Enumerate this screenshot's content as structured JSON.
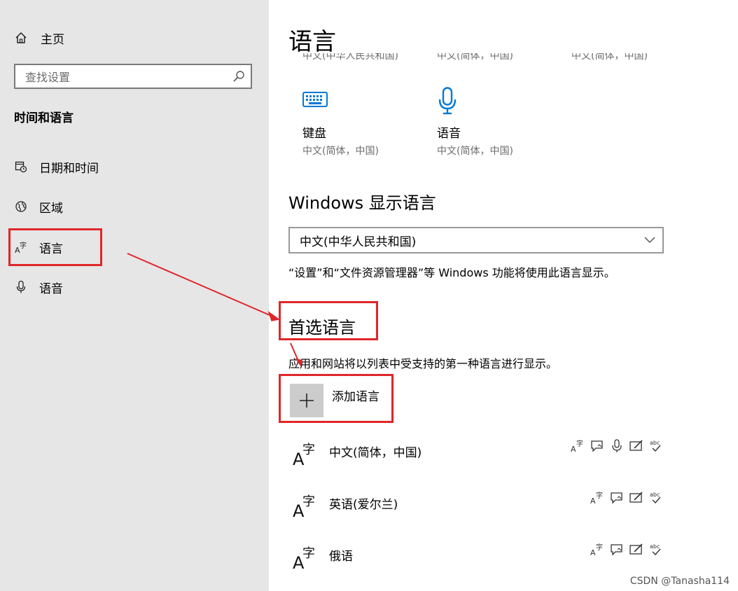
{
  "sidebar": {
    "home_label": "主页",
    "search_placeholder": "查找设置",
    "section_title": "时间和语言",
    "items": [
      {
        "label": "日期和时间",
        "icon": "calendar-clock-icon"
      },
      {
        "label": "区域",
        "icon": "globe-icon"
      },
      {
        "label": "语言",
        "icon": "language-icon"
      },
      {
        "label": "语音",
        "icon": "microphone-icon"
      }
    ]
  },
  "main": {
    "title": "语言",
    "clipped_top": [
      "中文(中华人民共和国)",
      "中文(简体，中国)",
      "中文(简体，中国)"
    ],
    "tiles": [
      {
        "name": "键盘",
        "sub": "中文(简体，中国)",
        "icon": "keyboard-icon"
      },
      {
        "name": "语音",
        "sub": "中文(简体，中国)",
        "icon": "microphone-icon"
      }
    ],
    "display_language": {
      "heading": "Windows 显示语言",
      "selected": "中文(中华人民共和国)",
      "description": "“设置”和“文件资源管理器”等 Windows 功能将使用此语言显示。"
    },
    "preferred": {
      "heading": "首选语言",
      "description": "应用和网站将以列表中受支持的第一种语言进行显示。",
      "add_label": "添加语言",
      "languages": [
        {
          "name": "中文(简体，中国)",
          "features": [
            "display-language-icon",
            "speech-bubble-icon",
            "microphone-icon",
            "handwriting-icon",
            "spellcheck-icon"
          ]
        },
        {
          "name": "英语(爱尔兰)",
          "features": [
            "display-language-icon",
            "speech-bubble-icon",
            "handwriting-icon",
            "spellcheck-icon"
          ]
        },
        {
          "name": "俄语",
          "features": [
            "display-language-icon",
            "speech-bubble-icon",
            "handwriting-icon",
            "spellcheck-icon"
          ]
        }
      ]
    }
  },
  "watermark": "CSDN @Tanasha114",
  "colors": {
    "annotation_red": "#e0262a",
    "accent_blue": "#0078d7",
    "sidebar_bg": "#e6e6e6"
  }
}
